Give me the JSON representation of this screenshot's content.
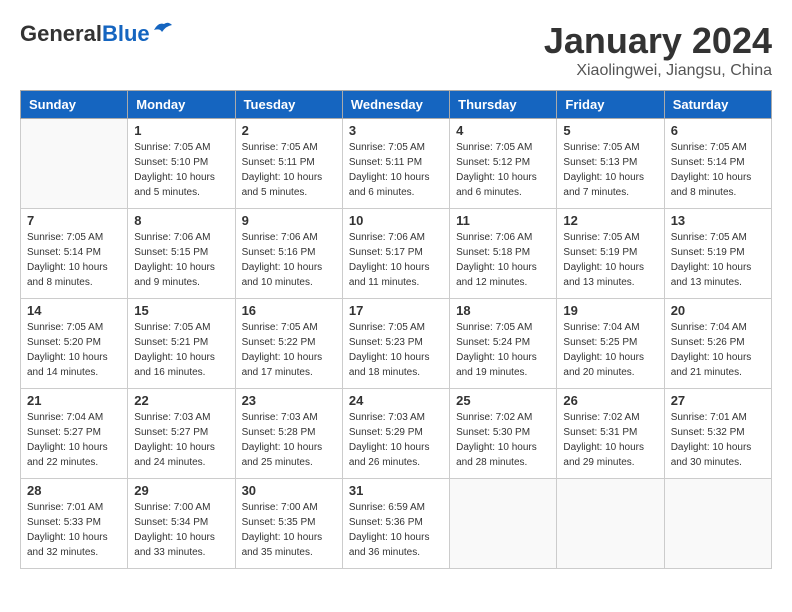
{
  "header": {
    "logo_general": "General",
    "logo_blue": "Blue",
    "month_title": "January 2024",
    "location": "Xiaolingwei, Jiangsu, China"
  },
  "days_of_week": [
    "Sunday",
    "Monday",
    "Tuesday",
    "Wednesday",
    "Thursday",
    "Friday",
    "Saturday"
  ],
  "weeks": [
    [
      {
        "day": null
      },
      {
        "day": "1",
        "sunrise": "7:05 AM",
        "sunset": "5:10 PM",
        "daylight": "10 hours and 5 minutes."
      },
      {
        "day": "2",
        "sunrise": "7:05 AM",
        "sunset": "5:11 PM",
        "daylight": "10 hours and 5 minutes."
      },
      {
        "day": "3",
        "sunrise": "7:05 AM",
        "sunset": "5:11 PM",
        "daylight": "10 hours and 6 minutes."
      },
      {
        "day": "4",
        "sunrise": "7:05 AM",
        "sunset": "5:12 PM",
        "daylight": "10 hours and 6 minutes."
      },
      {
        "day": "5",
        "sunrise": "7:05 AM",
        "sunset": "5:13 PM",
        "daylight": "10 hours and 7 minutes."
      },
      {
        "day": "6",
        "sunrise": "7:05 AM",
        "sunset": "5:14 PM",
        "daylight": "10 hours and 8 minutes."
      }
    ],
    [
      {
        "day": "7",
        "sunrise": "7:05 AM",
        "sunset": "5:14 PM",
        "daylight": "10 hours and 8 minutes."
      },
      {
        "day": "8",
        "sunrise": "7:06 AM",
        "sunset": "5:15 PM",
        "daylight": "10 hours and 9 minutes."
      },
      {
        "day": "9",
        "sunrise": "7:06 AM",
        "sunset": "5:16 PM",
        "daylight": "10 hours and 10 minutes."
      },
      {
        "day": "10",
        "sunrise": "7:06 AM",
        "sunset": "5:17 PM",
        "daylight": "10 hours and 11 minutes."
      },
      {
        "day": "11",
        "sunrise": "7:06 AM",
        "sunset": "5:18 PM",
        "daylight": "10 hours and 12 minutes."
      },
      {
        "day": "12",
        "sunrise": "7:05 AM",
        "sunset": "5:19 PM",
        "daylight": "10 hours and 13 minutes."
      },
      {
        "day": "13",
        "sunrise": "7:05 AM",
        "sunset": "5:19 PM",
        "daylight": "10 hours and 13 minutes."
      }
    ],
    [
      {
        "day": "14",
        "sunrise": "7:05 AM",
        "sunset": "5:20 PM",
        "daylight": "10 hours and 14 minutes."
      },
      {
        "day": "15",
        "sunrise": "7:05 AM",
        "sunset": "5:21 PM",
        "daylight": "10 hours and 16 minutes."
      },
      {
        "day": "16",
        "sunrise": "7:05 AM",
        "sunset": "5:22 PM",
        "daylight": "10 hours and 17 minutes."
      },
      {
        "day": "17",
        "sunrise": "7:05 AM",
        "sunset": "5:23 PM",
        "daylight": "10 hours and 18 minutes."
      },
      {
        "day": "18",
        "sunrise": "7:05 AM",
        "sunset": "5:24 PM",
        "daylight": "10 hours and 19 minutes."
      },
      {
        "day": "19",
        "sunrise": "7:04 AM",
        "sunset": "5:25 PM",
        "daylight": "10 hours and 20 minutes."
      },
      {
        "day": "20",
        "sunrise": "7:04 AM",
        "sunset": "5:26 PM",
        "daylight": "10 hours and 21 minutes."
      }
    ],
    [
      {
        "day": "21",
        "sunrise": "7:04 AM",
        "sunset": "5:27 PM",
        "daylight": "10 hours and 22 minutes."
      },
      {
        "day": "22",
        "sunrise": "7:03 AM",
        "sunset": "5:27 PM",
        "daylight": "10 hours and 24 minutes."
      },
      {
        "day": "23",
        "sunrise": "7:03 AM",
        "sunset": "5:28 PM",
        "daylight": "10 hours and 25 minutes."
      },
      {
        "day": "24",
        "sunrise": "7:03 AM",
        "sunset": "5:29 PM",
        "daylight": "10 hours and 26 minutes."
      },
      {
        "day": "25",
        "sunrise": "7:02 AM",
        "sunset": "5:30 PM",
        "daylight": "10 hours and 28 minutes."
      },
      {
        "day": "26",
        "sunrise": "7:02 AM",
        "sunset": "5:31 PM",
        "daylight": "10 hours and 29 minutes."
      },
      {
        "day": "27",
        "sunrise": "7:01 AM",
        "sunset": "5:32 PM",
        "daylight": "10 hours and 30 minutes."
      }
    ],
    [
      {
        "day": "28",
        "sunrise": "7:01 AM",
        "sunset": "5:33 PM",
        "daylight": "10 hours and 32 minutes."
      },
      {
        "day": "29",
        "sunrise": "7:00 AM",
        "sunset": "5:34 PM",
        "daylight": "10 hours and 33 minutes."
      },
      {
        "day": "30",
        "sunrise": "7:00 AM",
        "sunset": "5:35 PM",
        "daylight": "10 hours and 35 minutes."
      },
      {
        "day": "31",
        "sunrise": "6:59 AM",
        "sunset": "5:36 PM",
        "daylight": "10 hours and 36 minutes."
      },
      {
        "day": null
      },
      {
        "day": null
      },
      {
        "day": null
      }
    ]
  ]
}
